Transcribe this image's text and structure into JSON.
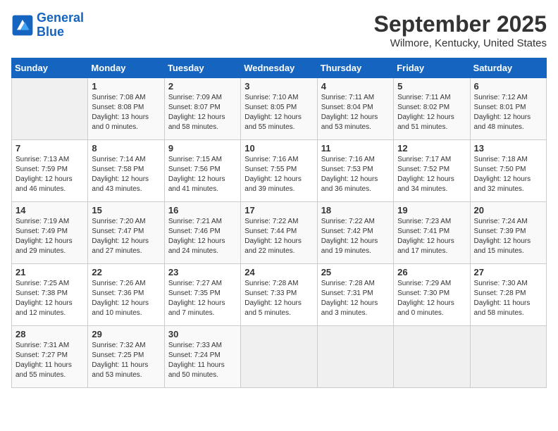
{
  "header": {
    "logo_line1": "General",
    "logo_line2": "Blue",
    "month": "September 2025",
    "location": "Wilmore, Kentucky, United States"
  },
  "days_of_week": [
    "Sunday",
    "Monday",
    "Tuesday",
    "Wednesday",
    "Thursday",
    "Friday",
    "Saturday"
  ],
  "weeks": [
    [
      {
        "day": "",
        "info": ""
      },
      {
        "day": "1",
        "info": "Sunrise: 7:08 AM\nSunset: 8:08 PM\nDaylight: 13 hours\nand 0 minutes."
      },
      {
        "day": "2",
        "info": "Sunrise: 7:09 AM\nSunset: 8:07 PM\nDaylight: 12 hours\nand 58 minutes."
      },
      {
        "day": "3",
        "info": "Sunrise: 7:10 AM\nSunset: 8:05 PM\nDaylight: 12 hours\nand 55 minutes."
      },
      {
        "day": "4",
        "info": "Sunrise: 7:11 AM\nSunset: 8:04 PM\nDaylight: 12 hours\nand 53 minutes."
      },
      {
        "day": "5",
        "info": "Sunrise: 7:11 AM\nSunset: 8:02 PM\nDaylight: 12 hours\nand 51 minutes."
      },
      {
        "day": "6",
        "info": "Sunrise: 7:12 AM\nSunset: 8:01 PM\nDaylight: 12 hours\nand 48 minutes."
      }
    ],
    [
      {
        "day": "7",
        "info": "Sunrise: 7:13 AM\nSunset: 7:59 PM\nDaylight: 12 hours\nand 46 minutes."
      },
      {
        "day": "8",
        "info": "Sunrise: 7:14 AM\nSunset: 7:58 PM\nDaylight: 12 hours\nand 43 minutes."
      },
      {
        "day": "9",
        "info": "Sunrise: 7:15 AM\nSunset: 7:56 PM\nDaylight: 12 hours\nand 41 minutes."
      },
      {
        "day": "10",
        "info": "Sunrise: 7:16 AM\nSunset: 7:55 PM\nDaylight: 12 hours\nand 39 minutes."
      },
      {
        "day": "11",
        "info": "Sunrise: 7:16 AM\nSunset: 7:53 PM\nDaylight: 12 hours\nand 36 minutes."
      },
      {
        "day": "12",
        "info": "Sunrise: 7:17 AM\nSunset: 7:52 PM\nDaylight: 12 hours\nand 34 minutes."
      },
      {
        "day": "13",
        "info": "Sunrise: 7:18 AM\nSunset: 7:50 PM\nDaylight: 12 hours\nand 32 minutes."
      }
    ],
    [
      {
        "day": "14",
        "info": "Sunrise: 7:19 AM\nSunset: 7:49 PM\nDaylight: 12 hours\nand 29 minutes."
      },
      {
        "day": "15",
        "info": "Sunrise: 7:20 AM\nSunset: 7:47 PM\nDaylight: 12 hours\nand 27 minutes."
      },
      {
        "day": "16",
        "info": "Sunrise: 7:21 AM\nSunset: 7:46 PM\nDaylight: 12 hours\nand 24 minutes."
      },
      {
        "day": "17",
        "info": "Sunrise: 7:22 AM\nSunset: 7:44 PM\nDaylight: 12 hours\nand 22 minutes."
      },
      {
        "day": "18",
        "info": "Sunrise: 7:22 AM\nSunset: 7:42 PM\nDaylight: 12 hours\nand 19 minutes."
      },
      {
        "day": "19",
        "info": "Sunrise: 7:23 AM\nSunset: 7:41 PM\nDaylight: 12 hours\nand 17 minutes."
      },
      {
        "day": "20",
        "info": "Sunrise: 7:24 AM\nSunset: 7:39 PM\nDaylight: 12 hours\nand 15 minutes."
      }
    ],
    [
      {
        "day": "21",
        "info": "Sunrise: 7:25 AM\nSunset: 7:38 PM\nDaylight: 12 hours\nand 12 minutes."
      },
      {
        "day": "22",
        "info": "Sunrise: 7:26 AM\nSunset: 7:36 PM\nDaylight: 12 hours\nand 10 minutes."
      },
      {
        "day": "23",
        "info": "Sunrise: 7:27 AM\nSunset: 7:35 PM\nDaylight: 12 hours\nand 7 minutes."
      },
      {
        "day": "24",
        "info": "Sunrise: 7:28 AM\nSunset: 7:33 PM\nDaylight: 12 hours\nand 5 minutes."
      },
      {
        "day": "25",
        "info": "Sunrise: 7:28 AM\nSunset: 7:31 PM\nDaylight: 12 hours\nand 3 minutes."
      },
      {
        "day": "26",
        "info": "Sunrise: 7:29 AM\nSunset: 7:30 PM\nDaylight: 12 hours\nand 0 minutes."
      },
      {
        "day": "27",
        "info": "Sunrise: 7:30 AM\nSunset: 7:28 PM\nDaylight: 11 hours\nand 58 minutes."
      }
    ],
    [
      {
        "day": "28",
        "info": "Sunrise: 7:31 AM\nSunset: 7:27 PM\nDaylight: 11 hours\nand 55 minutes."
      },
      {
        "day": "29",
        "info": "Sunrise: 7:32 AM\nSunset: 7:25 PM\nDaylight: 11 hours\nand 53 minutes."
      },
      {
        "day": "30",
        "info": "Sunrise: 7:33 AM\nSunset: 7:24 PM\nDaylight: 11 hours\nand 50 minutes."
      },
      {
        "day": "",
        "info": ""
      },
      {
        "day": "",
        "info": ""
      },
      {
        "day": "",
        "info": ""
      },
      {
        "day": "",
        "info": ""
      }
    ]
  ]
}
